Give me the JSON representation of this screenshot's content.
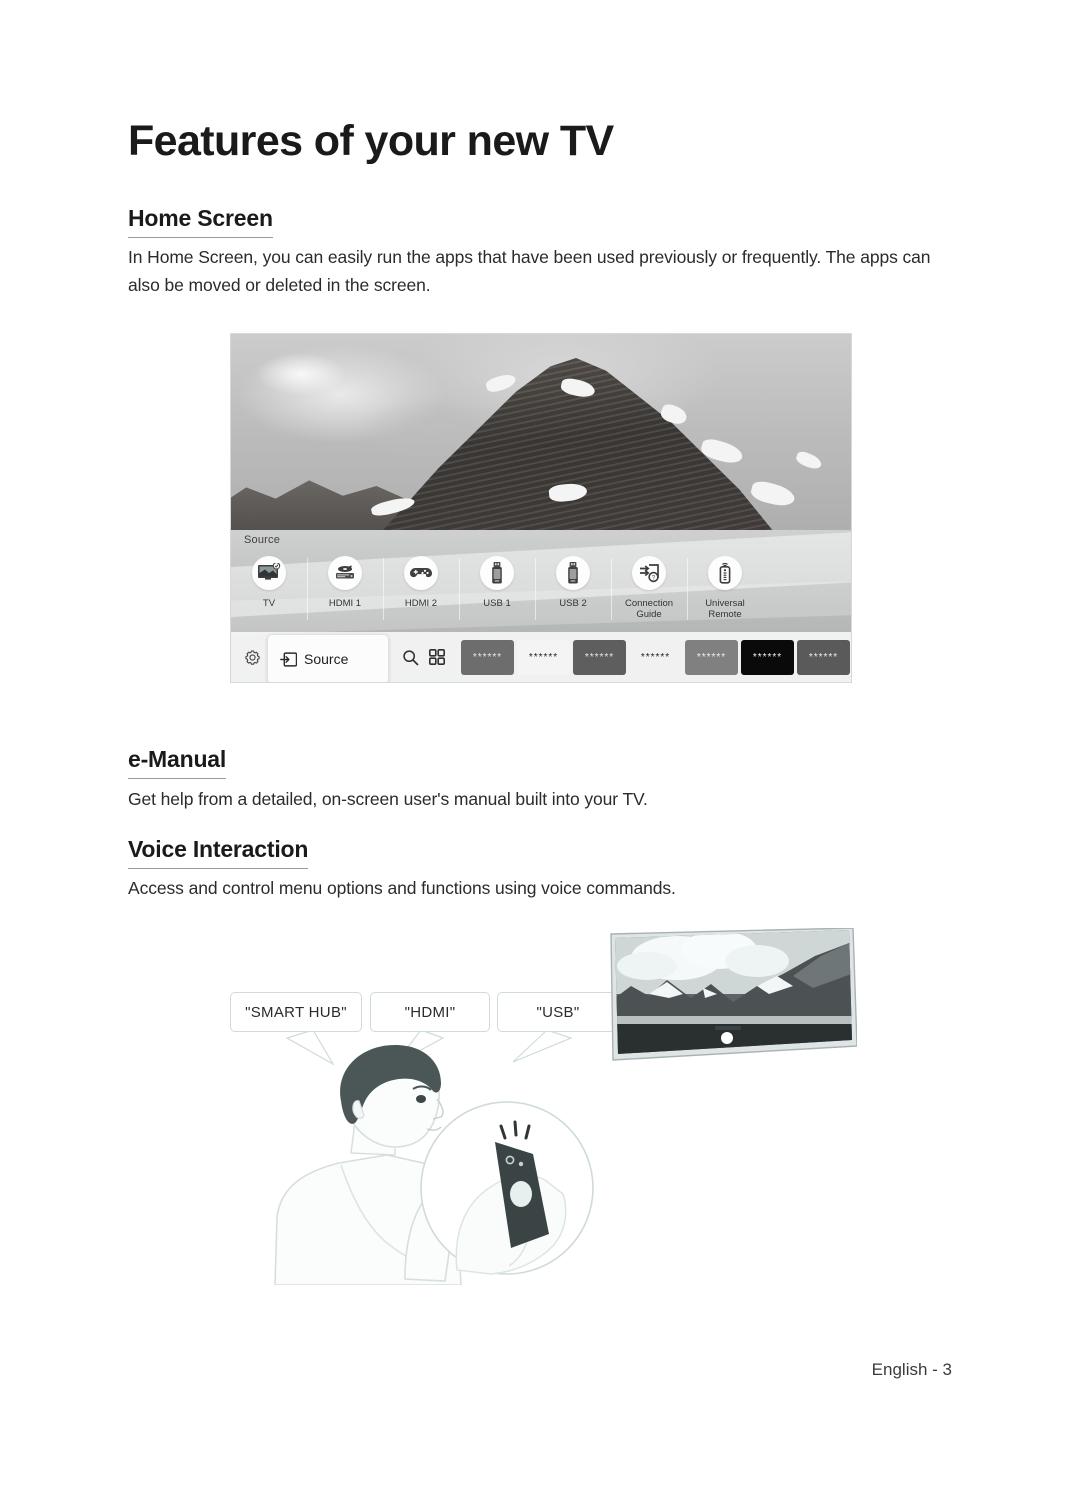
{
  "document": {
    "title": "Features of your new TV",
    "footer": "English - 3"
  },
  "sections": [
    {
      "heading": "Home Screen",
      "body": "In Home Screen, you can easily run the apps that have been used previously or frequently. The apps can also be moved or deleted in the screen."
    },
    {
      "heading": "e-Manual",
      "body": "Get help from a detailed, on-screen user's manual built into your TV."
    },
    {
      "heading": "Voice Interaction",
      "body": "Access and control menu options and functions using voice commands."
    }
  ],
  "home_screen_capture": {
    "source_label": "Source",
    "sources": [
      {
        "label": "TV",
        "icon": "tv-icon"
      },
      {
        "label": "HDMI 1",
        "icon": "bluray-player-icon"
      },
      {
        "label": "HDMI 2",
        "icon": "game-controller-icon"
      },
      {
        "label": "USB 1",
        "icon": "usb-drive-icon"
      },
      {
        "label": "USB 2",
        "icon": "usb-drive-icon"
      },
      {
        "label": "Connection\nGuide",
        "icon": "connection-guide-icon"
      },
      {
        "label": "Universal\nRemote",
        "icon": "universal-remote-icon"
      }
    ],
    "app_bar": {
      "settings_icon": "gear-icon",
      "source_button_label": "Source",
      "source_button_icon": "source-input-icon",
      "search_icon": "search-icon",
      "apps_icon": "apps-grid-icon",
      "app_tiles": [
        {
          "placeholder": "******",
          "bg": "#6d6d6d",
          "fg": "#e9e9e9"
        },
        {
          "placeholder": "******",
          "bg": "#f4f4f4",
          "fg": "#1d1d1d"
        },
        {
          "placeholder": "******",
          "bg": "#5e5e5e",
          "fg": "#e9e9e9"
        },
        {
          "placeholder": "******",
          "bg": "#f1f1f1",
          "fg": "#1d1d1d"
        },
        {
          "placeholder": "******",
          "bg": "#808080",
          "fg": "#f0f0f0"
        },
        {
          "placeholder": "******",
          "bg": "#0a0a0a",
          "fg": "#f2f2f2"
        },
        {
          "placeholder": "******",
          "bg": "#5a5a5a",
          "fg": "#ededed"
        },
        {
          "placeholder": "******",
          "bg": "#8b8b8b",
          "fg": "#f2f2f2"
        },
        {
          "placeholder": "***",
          "bg": "#111111",
          "fg": "#f2f2f2"
        }
      ]
    }
  },
  "voice_interaction_art": {
    "speech_bubbles": [
      "\"SMART HUB\"",
      "\"HDMI\"",
      "\"USB\""
    ],
    "person": "man-speaking-into-remote-illustration",
    "remote_detail": "remote-mic-button-zoom-circle",
    "tv": "tv-mountain-landscape-illustration"
  },
  "colors": {
    "text": "#231f20",
    "heading_rule": "#9a9a9a",
    "bubble_border": "#cfdada",
    "page_background": "#ffffff"
  }
}
